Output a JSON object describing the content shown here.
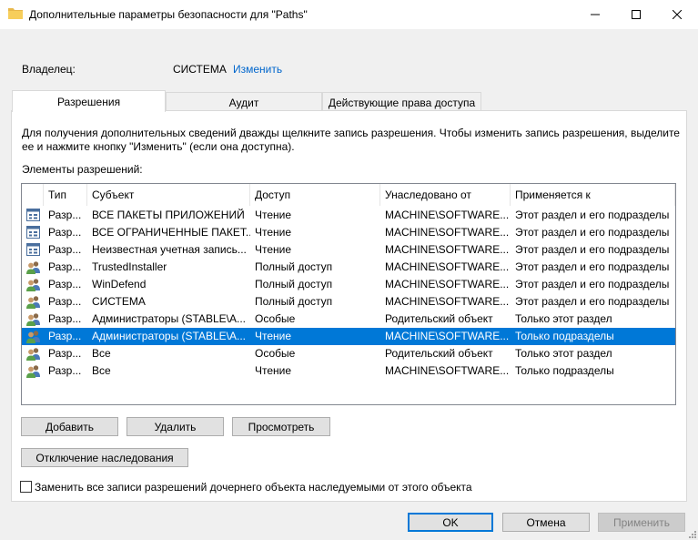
{
  "window": {
    "title": "Дополнительные параметры безопасности  для \"Paths\""
  },
  "owner": {
    "label": "Владелец:",
    "value": "СИСТЕМА",
    "change_link": "Изменить"
  },
  "tabs": [
    {
      "label": "Разрешения",
      "active": true
    },
    {
      "label": "Аудит",
      "active": false
    },
    {
      "label": "Действующие права доступа",
      "active": false
    }
  ],
  "description": "Для получения дополнительных сведений дважды щелкните запись разрешения. Чтобы изменить запись разрешения, выделите ее и нажмите кнопку \"Изменить\" (если она доступна).",
  "list_label": "Элементы разрешений:",
  "columns": [
    "Тип",
    "Субъект",
    "Доступ",
    "Унаследовано от",
    "Применяется к"
  ],
  "rows": [
    {
      "icon": "app-package-icon",
      "type": "Разр...",
      "subject": "ВСЕ ПАКЕТЫ ПРИЛОЖЕНИЙ",
      "access": "Чтение",
      "inherited": "MACHINE\\SOFTWARE...",
      "applies": "Этот раздел и его подразделы",
      "selected": false
    },
    {
      "icon": "app-package-icon",
      "type": "Разр...",
      "subject": "ВСЕ ОГРАНИЧЕННЫЕ ПАКЕТ...",
      "access": "Чтение",
      "inherited": "MACHINE\\SOFTWARE...",
      "applies": "Этот раздел и его подразделы",
      "selected": false
    },
    {
      "icon": "app-package-icon",
      "type": "Разр...",
      "subject": "Неизвестная учетная запись...",
      "access": "Чтение",
      "inherited": "MACHINE\\SOFTWARE...",
      "applies": "Этот раздел и его подразделы",
      "selected": false
    },
    {
      "icon": "users-icon",
      "type": "Разр...",
      "subject": "TrustedInstaller",
      "access": "Полный доступ",
      "inherited": "MACHINE\\SOFTWARE...",
      "applies": "Этот раздел и его подразделы",
      "selected": false
    },
    {
      "icon": "users-icon",
      "type": "Разр...",
      "subject": "WinDefend",
      "access": "Полный доступ",
      "inherited": "MACHINE\\SOFTWARE...",
      "applies": "Этот раздел и его подразделы",
      "selected": false
    },
    {
      "icon": "users-icon",
      "type": "Разр...",
      "subject": "СИСТЕМА",
      "access": "Полный доступ",
      "inherited": "MACHINE\\SOFTWARE...",
      "applies": "Этот раздел и его подразделы",
      "selected": false
    },
    {
      "icon": "users-icon",
      "type": "Разр...",
      "subject": "Администраторы (STABLE\\А...",
      "access": "Особые",
      "inherited": "Родительский объект",
      "applies": "Только этот раздел",
      "selected": false
    },
    {
      "icon": "users-icon",
      "type": "Разр...",
      "subject": "Администраторы (STABLE\\А...",
      "access": "Чтение",
      "inherited": "MACHINE\\SOFTWARE...",
      "applies": "Только подразделы",
      "selected": true
    },
    {
      "icon": "users-icon",
      "type": "Разр...",
      "subject": "Все",
      "access": "Особые",
      "inherited": "Родительский объект",
      "applies": "Только этот раздел",
      "selected": false
    },
    {
      "icon": "users-icon",
      "type": "Разр...",
      "subject": "Все",
      "access": "Чтение",
      "inherited": "MACHINE\\SOFTWARE...",
      "applies": "Только подразделы",
      "selected": false
    }
  ],
  "buttons": {
    "add": "Добавить",
    "remove": "Удалить",
    "view": "Просмотреть",
    "disable_inheritance": "Отключение наследования",
    "ok": "OK",
    "cancel": "Отмена",
    "apply": "Применить"
  },
  "replace_checkbox": {
    "label": "Заменить все записи разрешений дочернего объекта наследуемыми от этого объекта",
    "checked": false
  },
  "colors": {
    "selection": "#0078d7",
    "link": "#0066cc"
  }
}
